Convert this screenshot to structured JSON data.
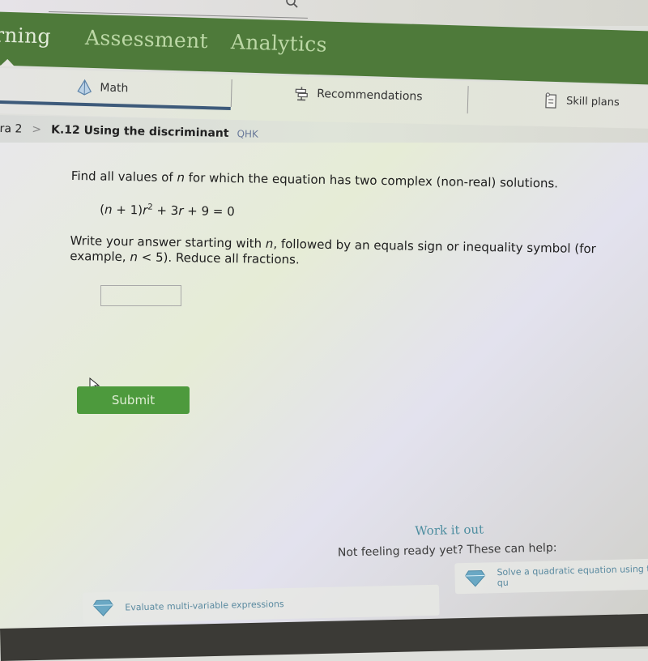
{
  "top_bar": {
    "search_icon": "search-icon"
  },
  "main_nav": {
    "items": [
      {
        "label": "rning",
        "active": true
      },
      {
        "label": "Assessment",
        "active": false
      },
      {
        "label": "Analytics",
        "active": false
      }
    ],
    "background_color": "#4e7a3a"
  },
  "sub_nav": {
    "tabs": [
      {
        "label": "Math",
        "icon": "pyramid-icon",
        "active": true
      },
      {
        "label": "Recommendations",
        "icon": "signpost-icon",
        "active": false
      },
      {
        "label": "Skill plans",
        "icon": "clipboard-icon",
        "active": false
      }
    ]
  },
  "breadcrumb": {
    "previous": "ra 2",
    "separator": ">",
    "current": "K.12 Using the discriminant",
    "code": "QHK"
  },
  "question": {
    "prompt_before_var": "Find all values of ",
    "variable": "n",
    "prompt_after_var": " for which the equation has two complex (non-real) solutions.",
    "equation_part1": "(",
    "equation_var_n": "n",
    "equation_part2": " + 1)",
    "equation_var_r": "r",
    "equation_exp": "2",
    "equation_part3": " + 3",
    "equation_var_r2": "r",
    "equation_part4": " + 9 = 0",
    "instr_part1": "Write your answer starting with ",
    "instr_var1": "n",
    "instr_part2": ", followed by an equals sign or inequality symbol (for example, ",
    "instr_var2": "n",
    "instr_part3": " < 5). Reduce all fractions."
  },
  "answer": {
    "value": "",
    "placeholder": ""
  },
  "submit": {
    "label": "Submit",
    "color": "#4d9a3d"
  },
  "help": {
    "title": "Work it out",
    "subtitle": "Not feeling ready yet? These can help:",
    "cards": [
      {
        "label": "Evaluate multi-variable expressions",
        "icon": "diamond-icon"
      },
      {
        "label": "Solve a quadratic equation using the qu",
        "icon": "diamond-icon"
      }
    ]
  }
}
